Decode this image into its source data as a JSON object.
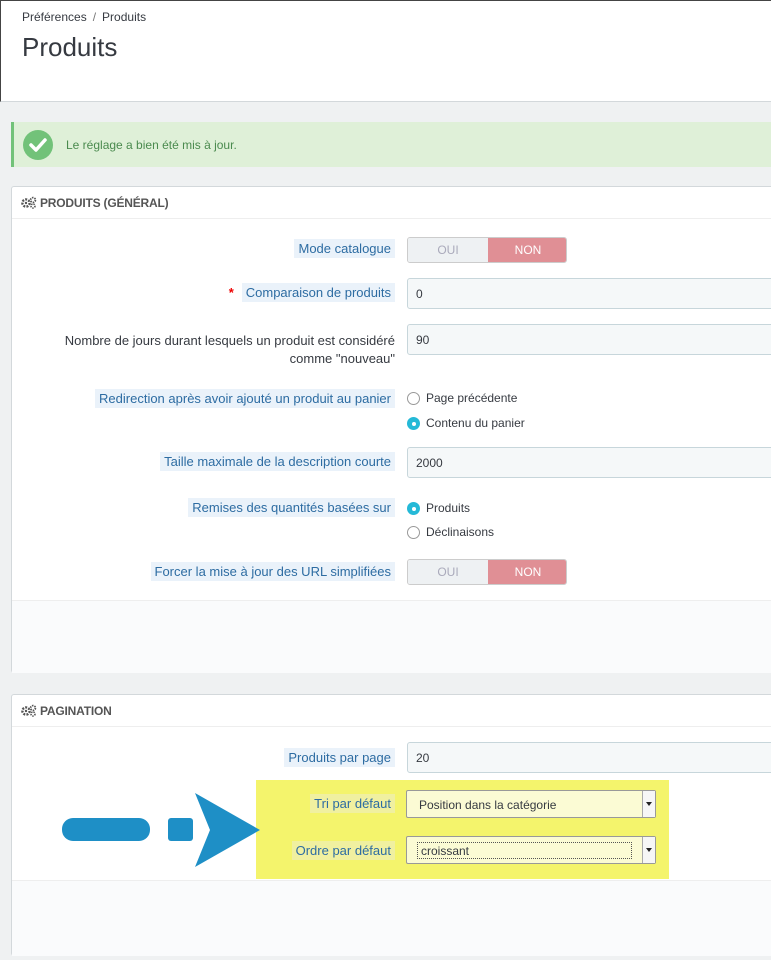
{
  "breadcrumb": {
    "parent": "Préférences",
    "separator": "/",
    "current": "Produits"
  },
  "page_title": "Produits",
  "alert": {
    "message": "Le réglage a bien été mis à jour."
  },
  "general": {
    "heading": "PRODUITS (GÉNÉRAL)",
    "mode_catalogue": {
      "label": "Mode catalogue",
      "oui": "OUI",
      "non": "NON",
      "value": "NON"
    },
    "comparaison": {
      "label": "Comparaison de produits",
      "required": "*",
      "value": "0"
    },
    "nouveau": {
      "label_line1": "Nombre de jours durant lesquels un produit est considéré",
      "label_line2": "comme \"nouveau\"",
      "value": "90"
    },
    "redirection": {
      "label": "Redirection après avoir ajouté un produit au panier",
      "options": [
        "Page précédente",
        "Contenu du panier"
      ],
      "selected": "Contenu du panier"
    },
    "taille": {
      "label": "Taille maximale de la description courte",
      "value": "2000"
    },
    "remises": {
      "label": "Remises des quantités basées sur",
      "options": [
        "Produits",
        "Déclinaisons"
      ],
      "selected": "Produits"
    },
    "forcer": {
      "label": "Forcer la mise à jour des URL simplifiées",
      "oui": "OUI",
      "non": "NON",
      "value": "NON"
    }
  },
  "pagination": {
    "heading": "PAGINATION",
    "par_page": {
      "label": "Produits par page",
      "value": "20"
    },
    "tri": {
      "label": "Tri par défaut",
      "value": "Position dans la catégorie"
    },
    "ordre": {
      "label": "Ordre par défaut",
      "value": "croissant"
    }
  },
  "colors": {
    "accent": "#25b9d7",
    "non_toggle": "#e08f95",
    "highlight": "#f4f46c",
    "arrow": "#1e8fc6",
    "success": "#72c279"
  }
}
